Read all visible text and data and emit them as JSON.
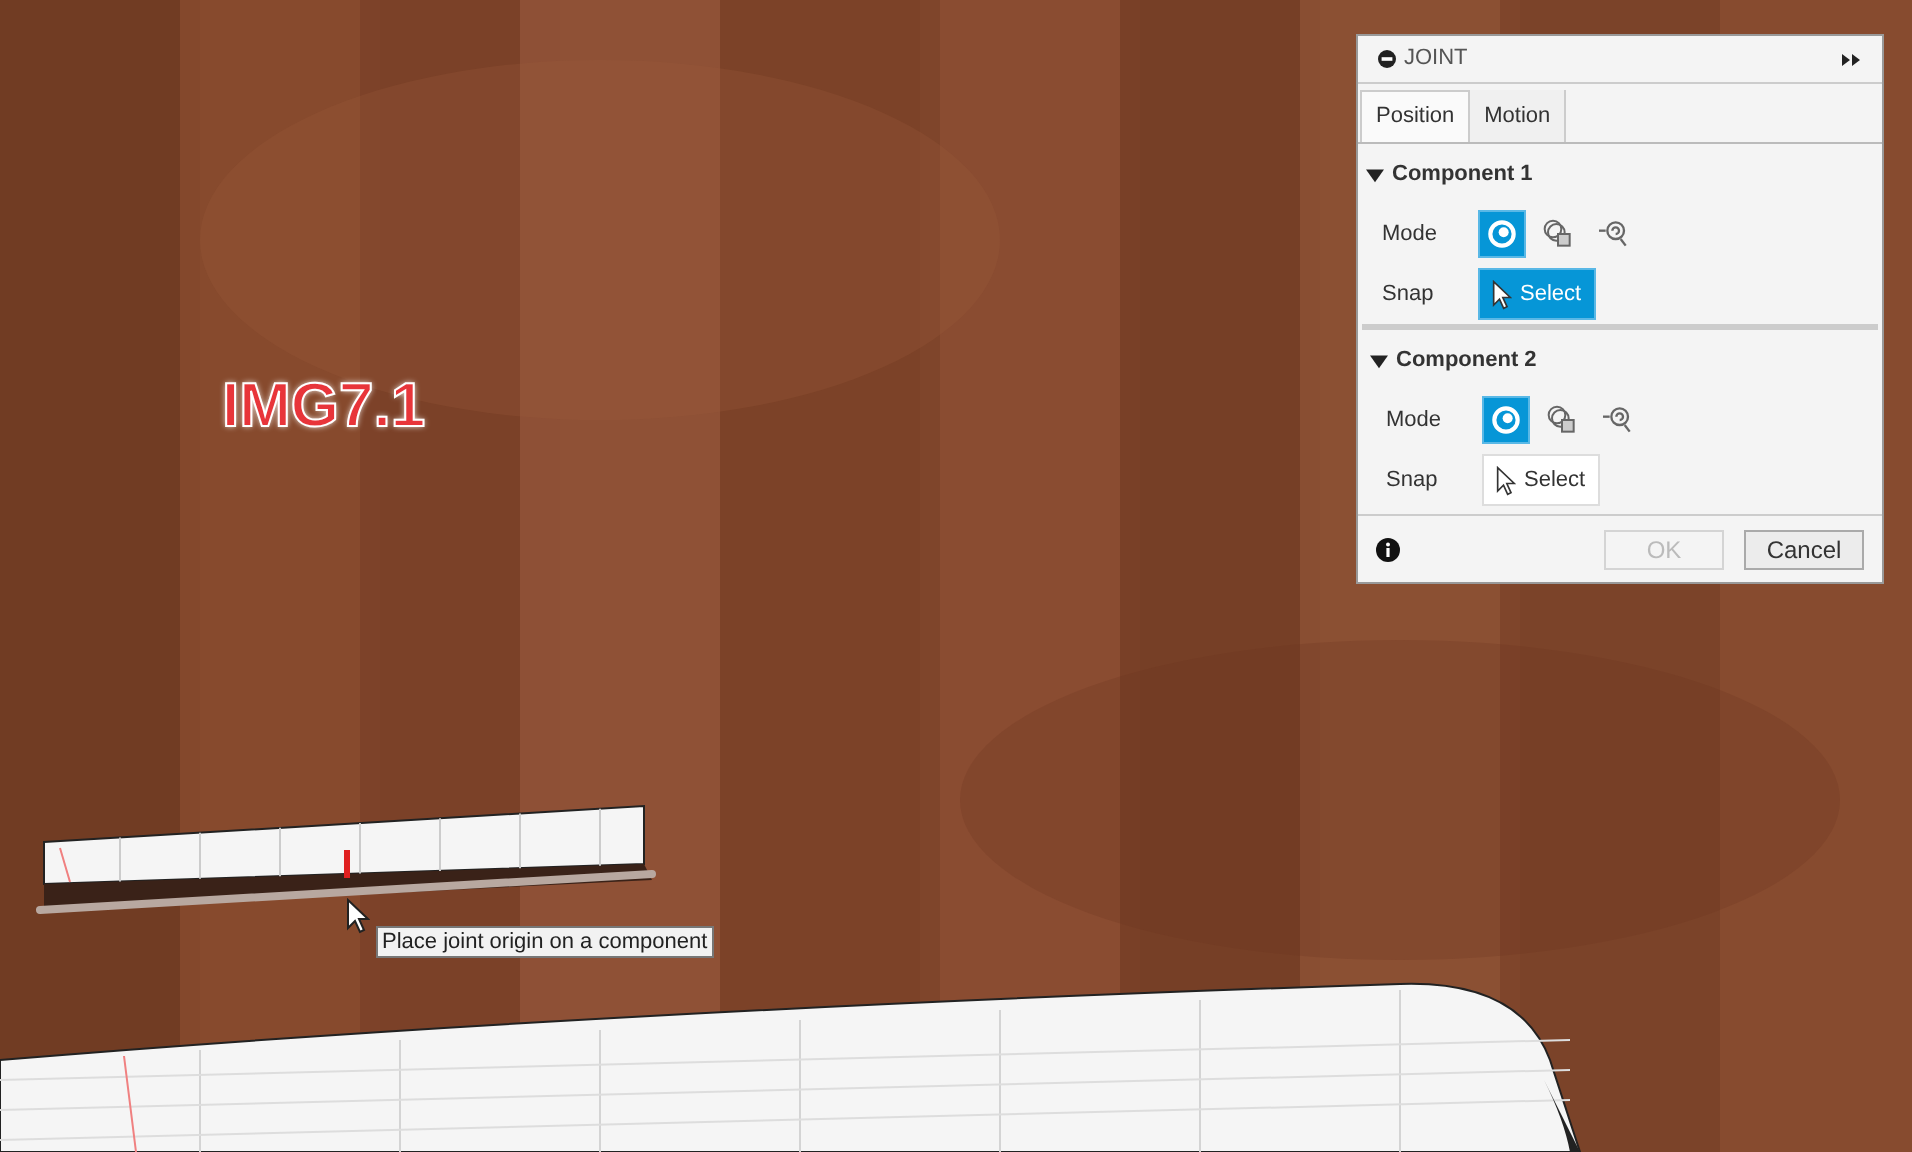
{
  "annotation": "IMG7.1",
  "tooltip": "Place joint origin on a component",
  "panel": {
    "title": "JOINT",
    "tabs": [
      {
        "label": "Position",
        "selected": true
      },
      {
        "label": "Motion",
        "selected": false
      }
    ],
    "sections": [
      {
        "title": "Component 1",
        "expanded": true,
        "mode_label": "Mode",
        "modes": [
          {
            "kind": "simple",
            "selected": true
          },
          {
            "kind": "between",
            "selected": false
          },
          {
            "kind": "two-faces",
            "selected": false
          }
        ],
        "snap_label": "Snap",
        "snap_button": {
          "label": "Select",
          "active": true
        }
      },
      {
        "title": "Component 2",
        "expanded": true,
        "mode_label": "Mode",
        "modes": [
          {
            "kind": "simple",
            "selected": true
          },
          {
            "kind": "between",
            "selected": false
          },
          {
            "kind": "two-faces",
            "selected": false
          }
        ],
        "snap_label": "Snap",
        "snap_button": {
          "label": "Select",
          "active": false
        }
      }
    ],
    "buttons": [
      {
        "label": "OK",
        "disabled": true
      },
      {
        "label": "Cancel",
        "disabled": false
      }
    ]
  }
}
